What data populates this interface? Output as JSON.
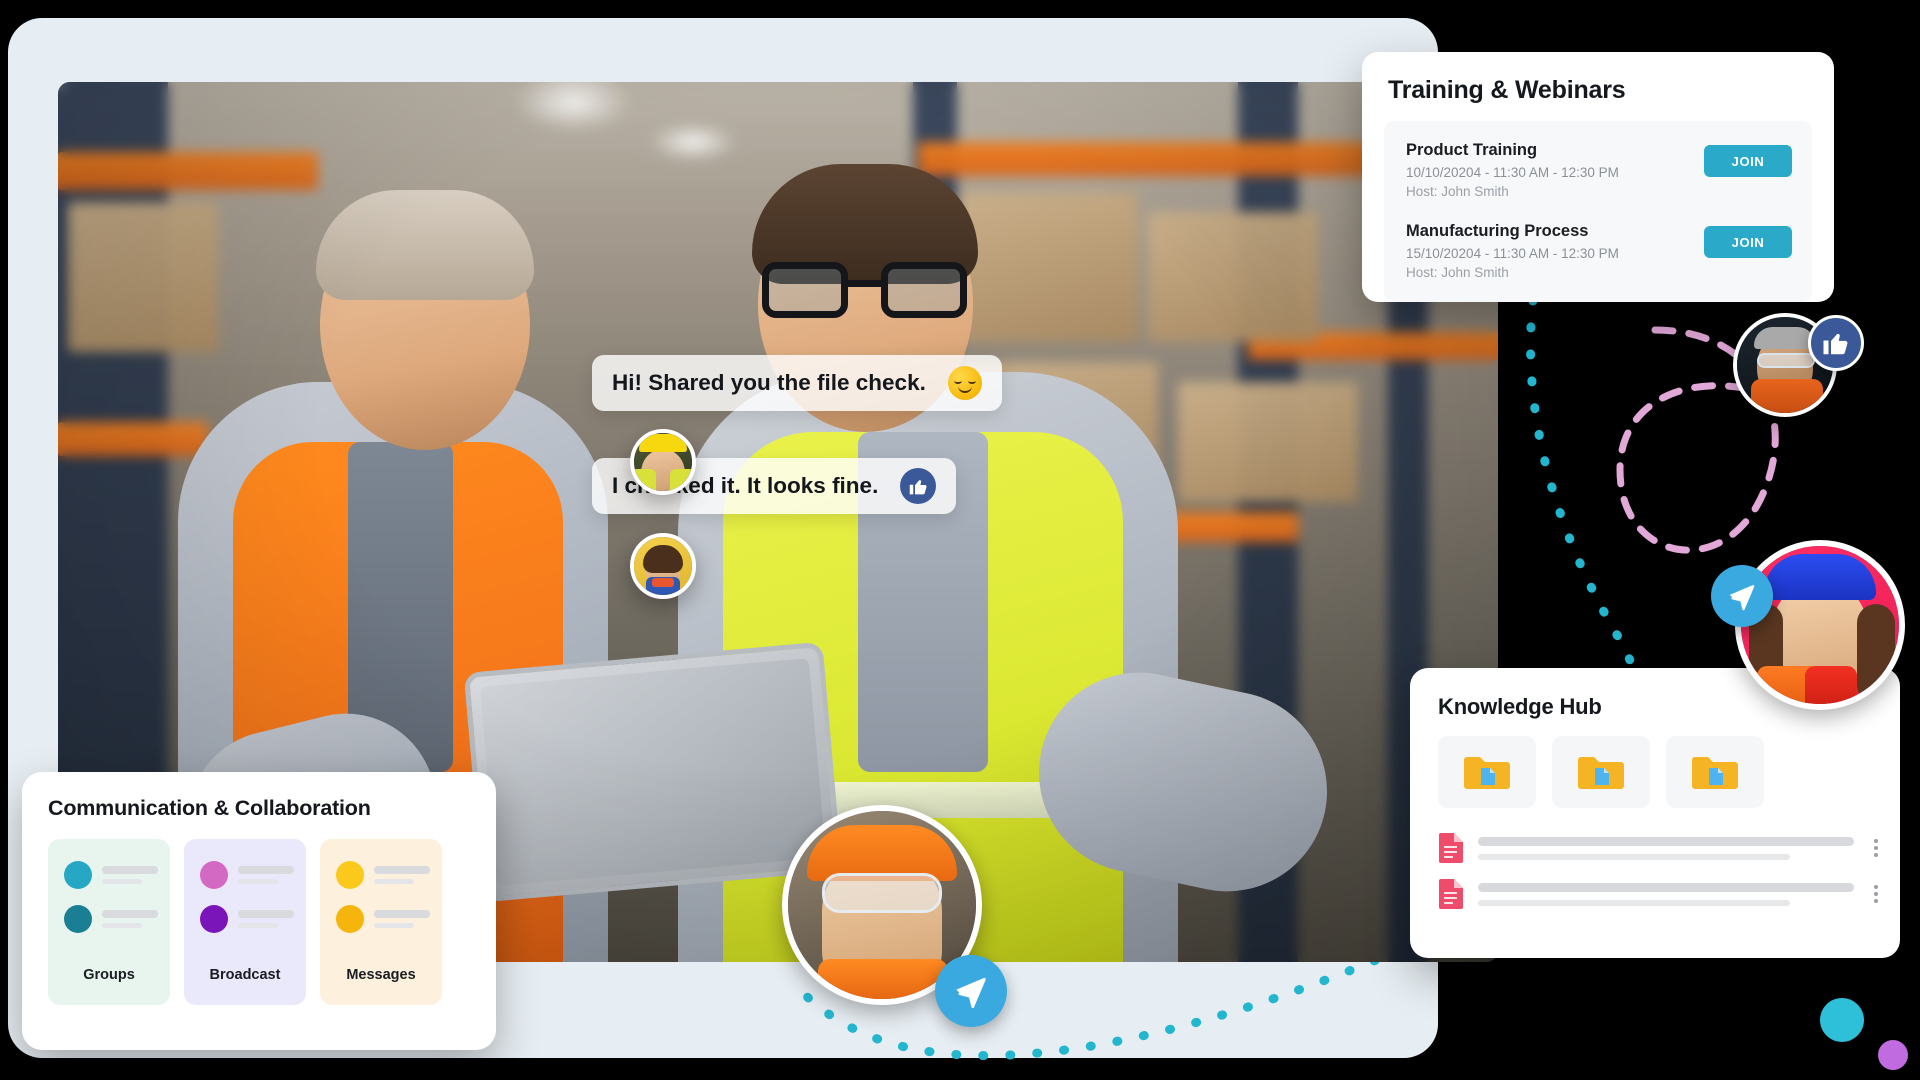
{
  "training": {
    "title": "Training & Webinars",
    "sessions": [
      {
        "name": "Product Training",
        "time": "10/10/20204 - 11:30 AM - 12:30 PM",
        "host": "Host: John Smith",
        "join_label": "JOIN"
      },
      {
        "name": "Manufacturing Process",
        "time": "15/10/20204 - 11:30 AM - 12:30 PM",
        "host": "Host: John Smith",
        "join_label": "JOIN"
      }
    ]
  },
  "communication": {
    "title": "Communication & Collaboration",
    "tiles": [
      {
        "label": "Groups",
        "bg": "#e7f5ee",
        "dot_top": "#26a8c4",
        "dot_bottom": "#1a7f94"
      },
      {
        "label": "Broadcast",
        "bg": "#eae8fb",
        "dot_top": "#d469c4",
        "dot_bottom": "#7a15ba"
      },
      {
        "label": "Messages",
        "bg": "#fdf0dd",
        "dot_top": "#fbc91b",
        "dot_bottom": "#f5b50c"
      }
    ]
  },
  "knowledge_hub": {
    "title": "Knowledge Hub",
    "folders": [
      {
        "name": "folder-1"
      },
      {
        "name": "folder-2"
      },
      {
        "name": "folder-3"
      }
    ],
    "documents": [
      {
        "name": "document-1"
      },
      {
        "name": "document-2"
      }
    ]
  },
  "chat": {
    "messages": [
      {
        "text": "Hi! Shared you the file check.",
        "reaction": "smiling-face-emoji",
        "sender": "male-worker-yellow-helmet"
      },
      {
        "text": "I checked it. It looks fine.",
        "reaction": "thumbs-up-badge",
        "sender": "female-worker-yellow-helmet"
      }
    ]
  },
  "avatars": [
    {
      "name": "avatar-chat-sender-1",
      "description": "male worker yellow helmet"
    },
    {
      "name": "avatar-chat-sender-2",
      "description": "female worker yellow helmet"
    },
    {
      "name": "avatar-bottom-center",
      "description": "young worker orange helmet goggles"
    },
    {
      "name": "avatar-top-right",
      "description": "worker safety glasses"
    },
    {
      "name": "avatar-right",
      "description": "female worker blue helmet"
    }
  ],
  "colors": {
    "accent_teal": "#2aa9c9",
    "send_blue": "#3aa9e0",
    "thumb_blue": "#3b5998",
    "backdrop": "#e7eef3",
    "page_bg": "#000000",
    "deco_teal": "#2ec0d8",
    "deco_purple": "#c06ce0",
    "dotted_path": "#23b7cf",
    "dashed_path": "#e2a8d8"
  }
}
